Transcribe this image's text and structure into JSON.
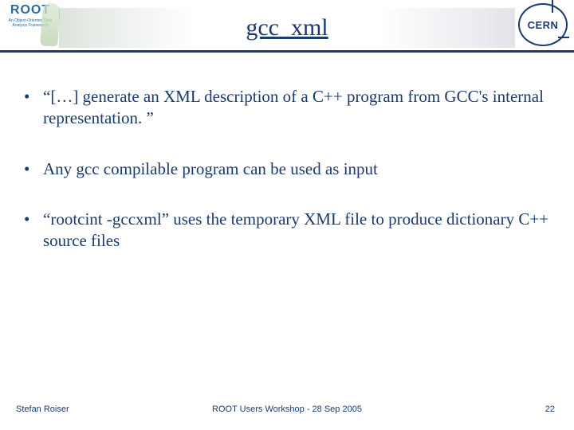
{
  "header": {
    "root_word": "ROOT",
    "root_tag": "An Object-Oriented\nData Analysis Framework",
    "cern_label": "CERN",
    "title": "gcc_xml"
  },
  "bullets": [
    "“[…] generate an XML description of a C++ program from GCC's internal representation. ”",
    "Any gcc compilable program can be used as input",
    "“rootcint -gccxml” uses the temporary XML file to produce dictionary C++ source files"
  ],
  "footer": {
    "author": "Stefan Roiser",
    "center": "ROOT Users Workshop  -  28 Sep 2005",
    "page": "22"
  }
}
